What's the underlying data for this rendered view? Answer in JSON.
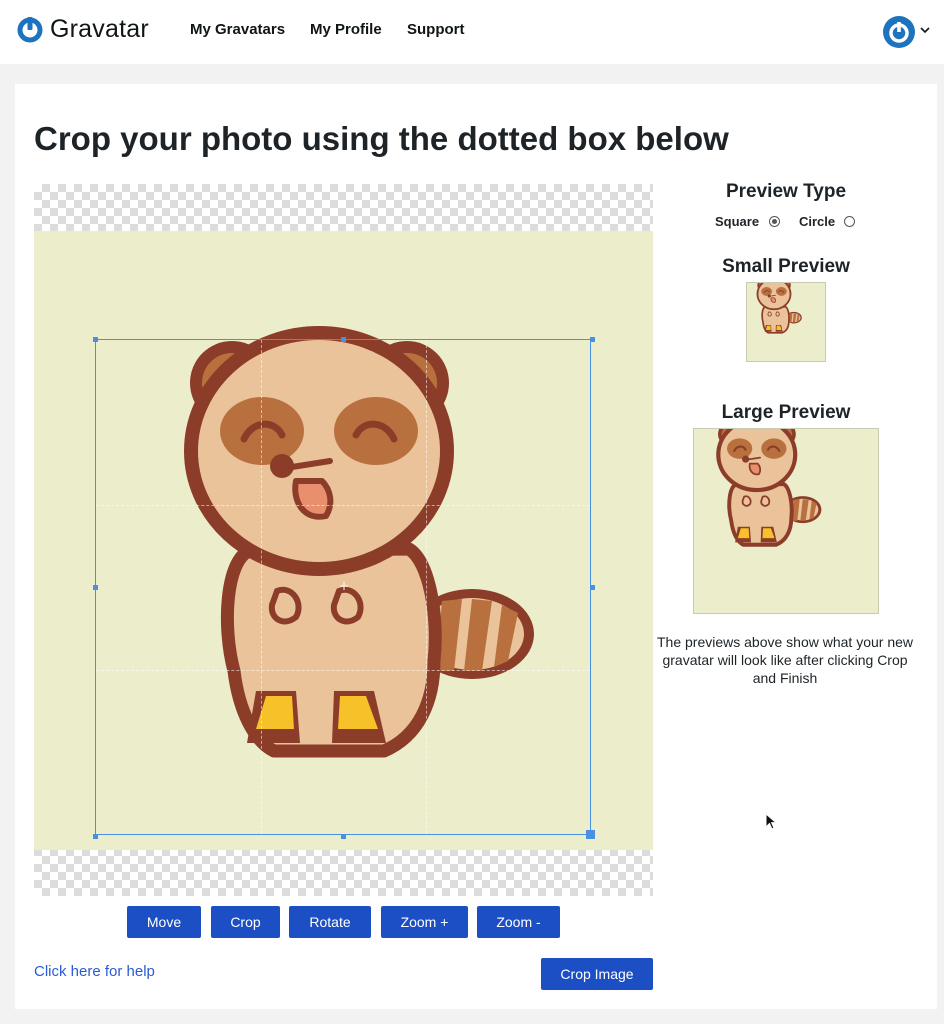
{
  "header": {
    "brand": "Gravatar",
    "nav": [
      {
        "label": "My Gravatars"
      },
      {
        "label": "My Profile"
      },
      {
        "label": "Support"
      }
    ],
    "colors": {
      "brand_blue": "#1e73be"
    }
  },
  "main": {
    "title": "Crop your photo using the dotted box below",
    "toolbar": [
      {
        "label": "Move"
      },
      {
        "label": "Crop"
      },
      {
        "label": "Rotate"
      },
      {
        "label": "Zoom +"
      },
      {
        "label": "Zoom -"
      }
    ],
    "help_link": "Click here for help",
    "crop_button": "Crop Image",
    "colors": {
      "button": "#1d4fc4",
      "photo_background": "#ecedcb",
      "crop_box": "#4a90e2"
    }
  },
  "sidebar": {
    "preview_type_heading": "Preview Type",
    "options": [
      {
        "label": "Square",
        "selected": true
      },
      {
        "label": "Circle",
        "selected": false
      }
    ],
    "small_preview_heading": "Small Preview",
    "large_preview_heading": "Large Preview",
    "note": "The previews above show what your new gravatar will look like after clicking Crop and Finish"
  }
}
